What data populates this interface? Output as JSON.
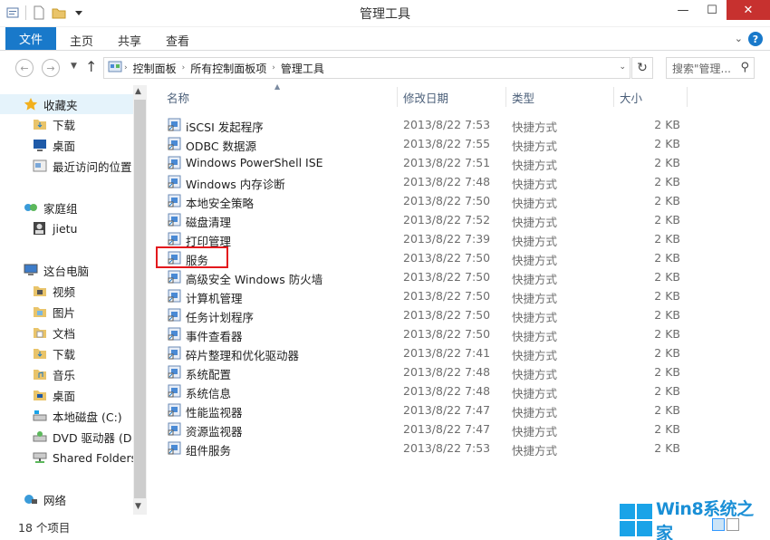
{
  "window": {
    "title": "管理工具"
  },
  "ribbon": {
    "file": "文件",
    "tabs": [
      "主页",
      "共享",
      "查看"
    ],
    "help": "?"
  },
  "address": {
    "crumbs": [
      "控制面板",
      "所有控制面板项",
      "管理工具"
    ],
    "search_placeholder": "搜索\"管理..."
  },
  "nav": {
    "items": [
      {
        "label": "收藏夹",
        "icon": "star-icon"
      },
      {
        "label": "下载",
        "icon": "folder-download-icon"
      },
      {
        "label": "桌面",
        "icon": "desktop-icon"
      },
      {
        "label": "最近访问的位置",
        "icon": "recent-places-icon"
      },
      {
        "label": "家庭组",
        "icon": "homegroup-icon"
      },
      {
        "label": "jietu",
        "icon": "user-icon"
      },
      {
        "label": "这台电脑",
        "icon": "computer-icon"
      },
      {
        "label": "视频",
        "icon": "folder-video-icon"
      },
      {
        "label": "图片",
        "icon": "folder-pictures-icon"
      },
      {
        "label": "文档",
        "icon": "folder-documents-icon"
      },
      {
        "label": "下载",
        "icon": "folder-download-icon"
      },
      {
        "label": "音乐",
        "icon": "folder-music-icon"
      },
      {
        "label": "桌面",
        "icon": "folder-desktop-icon"
      },
      {
        "label": "本地磁盘 (C:)",
        "icon": "drive-icon"
      },
      {
        "label": "DVD 驱动器 (D:)",
        "icon": "dvd-drive-icon"
      },
      {
        "label": "Shared Folders",
        "icon": "network-drive-icon"
      },
      {
        "label": "网络",
        "icon": "network-icon"
      }
    ]
  },
  "columns": {
    "name": "名称",
    "date": "修改日期",
    "type": "类型",
    "size": "大小"
  },
  "files": [
    {
      "name": "iSCSI 发起程序",
      "date": "2013/8/22 7:53",
      "type": "快捷方式",
      "size": "2 KB"
    },
    {
      "name": "ODBC 数据源",
      "date": "2013/8/22 7:55",
      "type": "快捷方式",
      "size": "2 KB"
    },
    {
      "name": "Windows PowerShell ISE",
      "date": "2013/8/22 7:51",
      "type": "快捷方式",
      "size": "2 KB"
    },
    {
      "name": "Windows 内存诊断",
      "date": "2013/8/22 7:48",
      "type": "快捷方式",
      "size": "2 KB"
    },
    {
      "name": "本地安全策略",
      "date": "2013/8/22 7:50",
      "type": "快捷方式",
      "size": "2 KB"
    },
    {
      "name": "磁盘清理",
      "date": "2013/8/22 7:52",
      "type": "快捷方式",
      "size": "2 KB"
    },
    {
      "name": "打印管理",
      "date": "2013/8/22 7:39",
      "type": "快捷方式",
      "size": "2 KB"
    },
    {
      "name": "服务",
      "date": "2013/8/22 7:50",
      "type": "快捷方式",
      "size": "2 KB"
    },
    {
      "name": "高级安全 Windows 防火墙",
      "date": "2013/8/22 7:50",
      "type": "快捷方式",
      "size": "2 KB"
    },
    {
      "name": "计算机管理",
      "date": "2013/8/22 7:50",
      "type": "快捷方式",
      "size": "2 KB"
    },
    {
      "name": "任务计划程序",
      "date": "2013/8/22 7:50",
      "type": "快捷方式",
      "size": "2 KB"
    },
    {
      "name": "事件查看器",
      "date": "2013/8/22 7:50",
      "type": "快捷方式",
      "size": "2 KB"
    },
    {
      "name": "碎片整理和优化驱动器",
      "date": "2013/8/22 7:41",
      "type": "快捷方式",
      "size": "2 KB"
    },
    {
      "name": "系统配置",
      "date": "2013/8/22 7:48",
      "type": "快捷方式",
      "size": "2 KB"
    },
    {
      "name": "系统信息",
      "date": "2013/8/22 7:48",
      "type": "快捷方式",
      "size": "2 KB"
    },
    {
      "name": "性能监视器",
      "date": "2013/8/22 7:47",
      "type": "快捷方式",
      "size": "2 KB"
    },
    {
      "name": "资源监视器",
      "date": "2013/8/22 7:47",
      "type": "快捷方式",
      "size": "2 KB"
    },
    {
      "name": "组件服务",
      "date": "2013/8/22 7:53",
      "type": "快捷方式",
      "size": "2 KB"
    }
  ],
  "status": {
    "count": "18 个项目"
  },
  "watermark": {
    "text": "Win8系统之家"
  },
  "colors": {
    "accent": "#1979ca",
    "close": "#c7312f",
    "highlight": "#e3191d"
  }
}
